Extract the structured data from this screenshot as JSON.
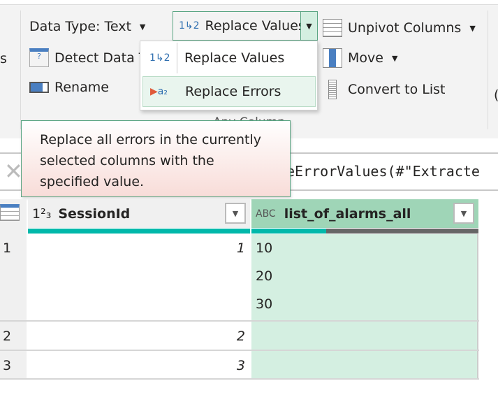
{
  "ribbon": {
    "left_partial": "s",
    "data_type": "Data Type: Text",
    "detect_data_type": "Detect Data T",
    "rename": "Rename",
    "replace_values": "Replace Values",
    "unpivot_columns": "Unpivot Columns",
    "move": "Move",
    "convert_to_list": "Convert to List",
    "group_label": "Any Column",
    "right_partial": "("
  },
  "dropdown_menu": {
    "items": [
      {
        "label": "Replace Values",
        "icon": "replace-values-icon"
      },
      {
        "label": "Replace Errors",
        "icon": "replace-errors-icon",
        "highlighted": true
      }
    ]
  },
  "tooltip": {
    "text": "Replace all errors in the currently selected columns with the specified value."
  },
  "formula_bar": {
    "text": "eErrorValues(#\"Extracte"
  },
  "table": {
    "columns": [
      {
        "name": "SessionId",
        "type_icon": "1²₃"
      },
      {
        "name": "list_of_alarms_all",
        "type_icon": "ABC"
      }
    ],
    "rows": [
      {
        "index": "1",
        "SessionId": "1",
        "list_of_alarms_all": [
          "10",
          "20",
          "30"
        ]
      },
      {
        "index": "2",
        "SessionId": "2",
        "list_of_alarms_all": []
      },
      {
        "index": "3",
        "SessionId": "3",
        "list_of_alarms_all": []
      }
    ],
    "column_quality": {
      "SessionId": 1.0,
      "list_of_alarms_all": 0.33
    }
  },
  "colors": {
    "accent": "#01b8aa",
    "selected_column": "#d4efe1",
    "selected_header": "#9fd5b7"
  }
}
